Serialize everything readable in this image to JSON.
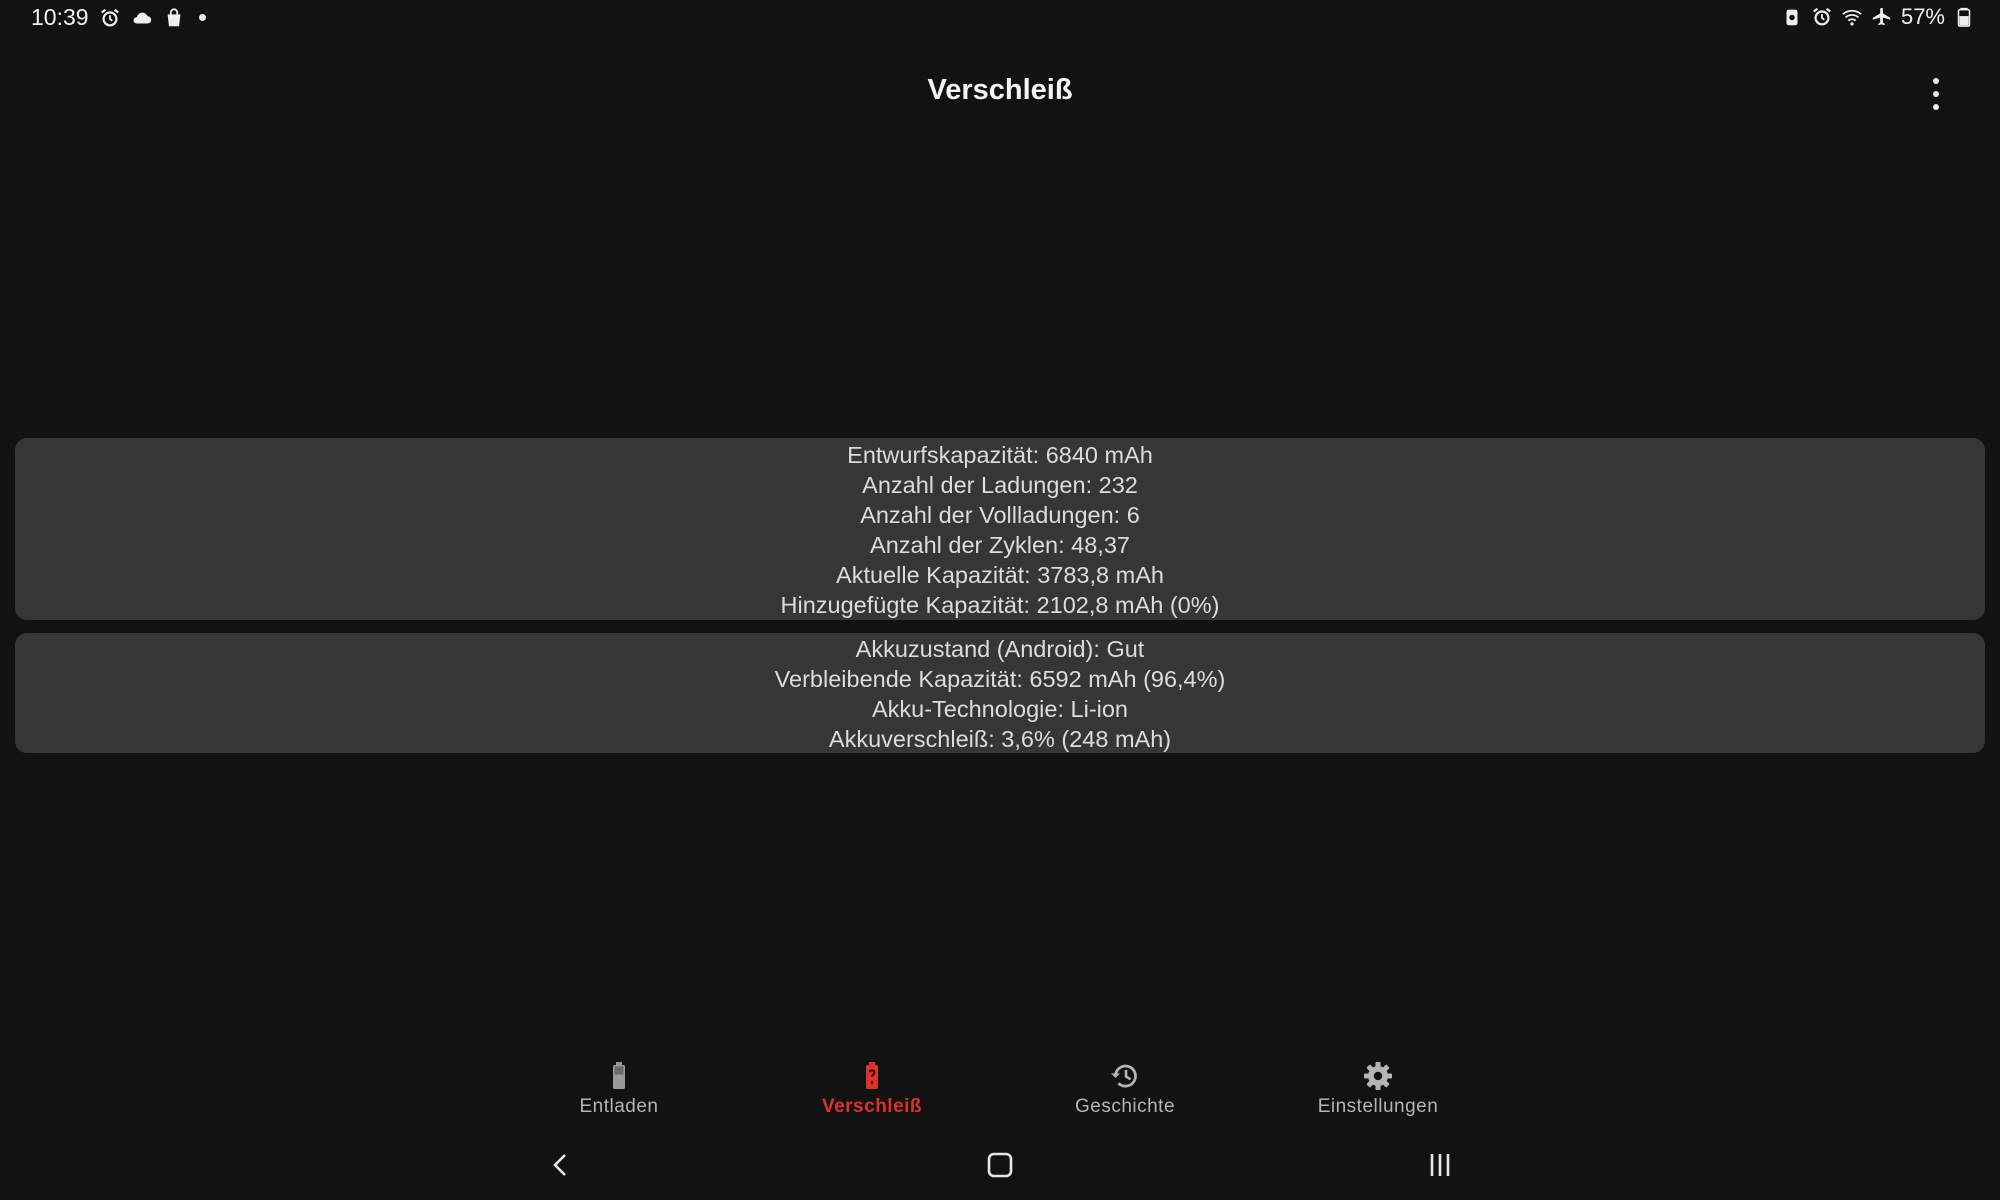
{
  "status_bar": {
    "time": "10:39",
    "battery_percent": "57%",
    "left_icons": [
      "alarm-icon",
      "cloud-icon",
      "shopping-bag-icon",
      "notification-dot"
    ],
    "right_icons": [
      "lock-battery-icon",
      "alarm-icon",
      "wifi-icon",
      "airplane-icon",
      "battery-icon"
    ]
  },
  "app_bar": {
    "title": "Verschleiß"
  },
  "card_1": {
    "lines": [
      "Entwurfskapazität: 6840 mAh",
      "Anzahl der Ladungen: 232",
      "Anzahl der Vollladungen: 6",
      "Anzahl der Zyklen: 48,37",
      "Aktuelle Kapazität: 3783,8 mAh",
      "Hinzugefügte Kapazität: 2102,8 mAh (0%)"
    ]
  },
  "card_2": {
    "lines": [
      "Akkuzustand (Android): Gut",
      "Verbleibende Kapazität: 6592 mAh (96,4%)",
      "Akku-Technologie: Li-ion",
      "Akkuverschleiß: 3,6% (248 mAh)"
    ]
  },
  "bottom_nav": {
    "items": [
      {
        "label": "Entladen",
        "icon": "battery-icon",
        "active": false
      },
      {
        "label": "Verschleiß",
        "icon": "battery-question-icon",
        "active": true
      },
      {
        "label": "Geschichte",
        "icon": "history-icon",
        "active": false
      },
      {
        "label": "Einstellungen",
        "icon": "gear-icon",
        "active": false
      }
    ]
  },
  "colors": {
    "background": "#121213",
    "card": "#363637",
    "accent": "#e0302a",
    "inactive": "#b4b4b4"
  }
}
